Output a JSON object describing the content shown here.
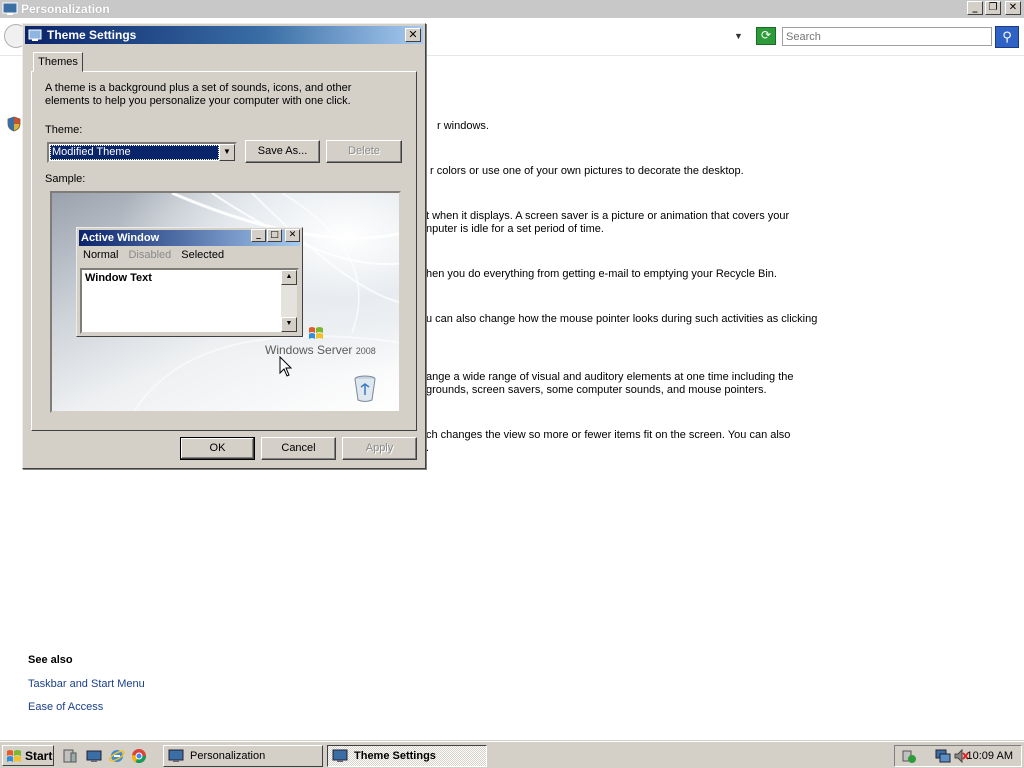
{
  "background_window": {
    "title": "Personalization",
    "search_placeholder": "Search",
    "task_fragments": [
      "r windows.",
      "r colors or use one of your own pictures to decorate the desktop.",
      "t when it displays. A screen saver is a picture or animation that covers your",
      "nputer is idle for a set period of time.",
      "hen you do everything from getting e-mail to emptying your Recycle Bin.",
      "u can also change how the mouse pointer looks during such activities as clicking",
      "ange a wide range of visual and auditory elements at one time including the",
      "grounds, screen savers, some computer sounds, and mouse pointers.",
      "ch changes the view so more or fewer items fit on the screen. You can also",
      "."
    ],
    "see_also": {
      "title": "See also",
      "links": [
        "Taskbar and Start Menu",
        "Ease of Access"
      ]
    }
  },
  "dialog": {
    "title": "Theme Settings",
    "tab_label": "Themes",
    "description": "A theme is a background plus a set of sounds, icons, and other elements to help you personalize your computer with one click.",
    "theme_label": "Theme:",
    "theme_value": "Modified Theme",
    "save_as_label": "Save As...",
    "delete_label": "Delete",
    "sample_label": "Sample:",
    "sample": {
      "window_title": "Active Window",
      "menu_normal": "Normal",
      "menu_disabled": "Disabled",
      "menu_selected": "Selected",
      "window_text": "Window Text",
      "logo_text": "Windows Server",
      "logo_year": "2008"
    },
    "ok_label": "OK",
    "cancel_label": "Cancel",
    "apply_label": "Apply"
  },
  "taskbar": {
    "start_label": "Start",
    "tasks": [
      {
        "label": "Personalization",
        "active": false
      },
      {
        "label": "Theme Settings",
        "active": true
      }
    ],
    "clock": "10:09 AM"
  },
  "colors": {
    "dialog_face": "#d4d0c8",
    "title_active": "#0a246a",
    "link": "#1a3f8a",
    "selection": "#0a246a"
  }
}
